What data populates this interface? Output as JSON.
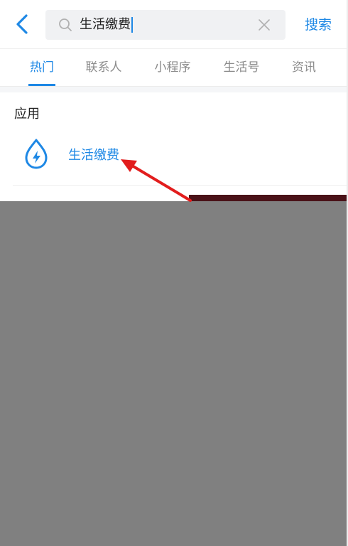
{
  "header": {
    "search": {
      "query": "生活缴费"
    },
    "search_button_label": "搜索"
  },
  "tabs": [
    {
      "label": "热门",
      "active": true
    },
    {
      "label": "联系人",
      "active": false
    },
    {
      "label": "小程序",
      "active": false
    },
    {
      "label": "生活号",
      "active": false
    },
    {
      "label": "资讯",
      "active": false
    }
  ],
  "sections": {
    "apps": {
      "title": "应用",
      "items": [
        {
          "label": "生活缴费",
          "icon": "water-drop-lightning-icon"
        }
      ]
    }
  },
  "icons": {
    "back": "chevron-left-icon",
    "search": "search-icon",
    "clear": "close-icon"
  },
  "colors": {
    "accent": "#1e88e5",
    "annotation": "#e21d1d",
    "overlay": "#808080",
    "text_primary": "#222222",
    "text_secondary": "#8c8c8c"
  }
}
